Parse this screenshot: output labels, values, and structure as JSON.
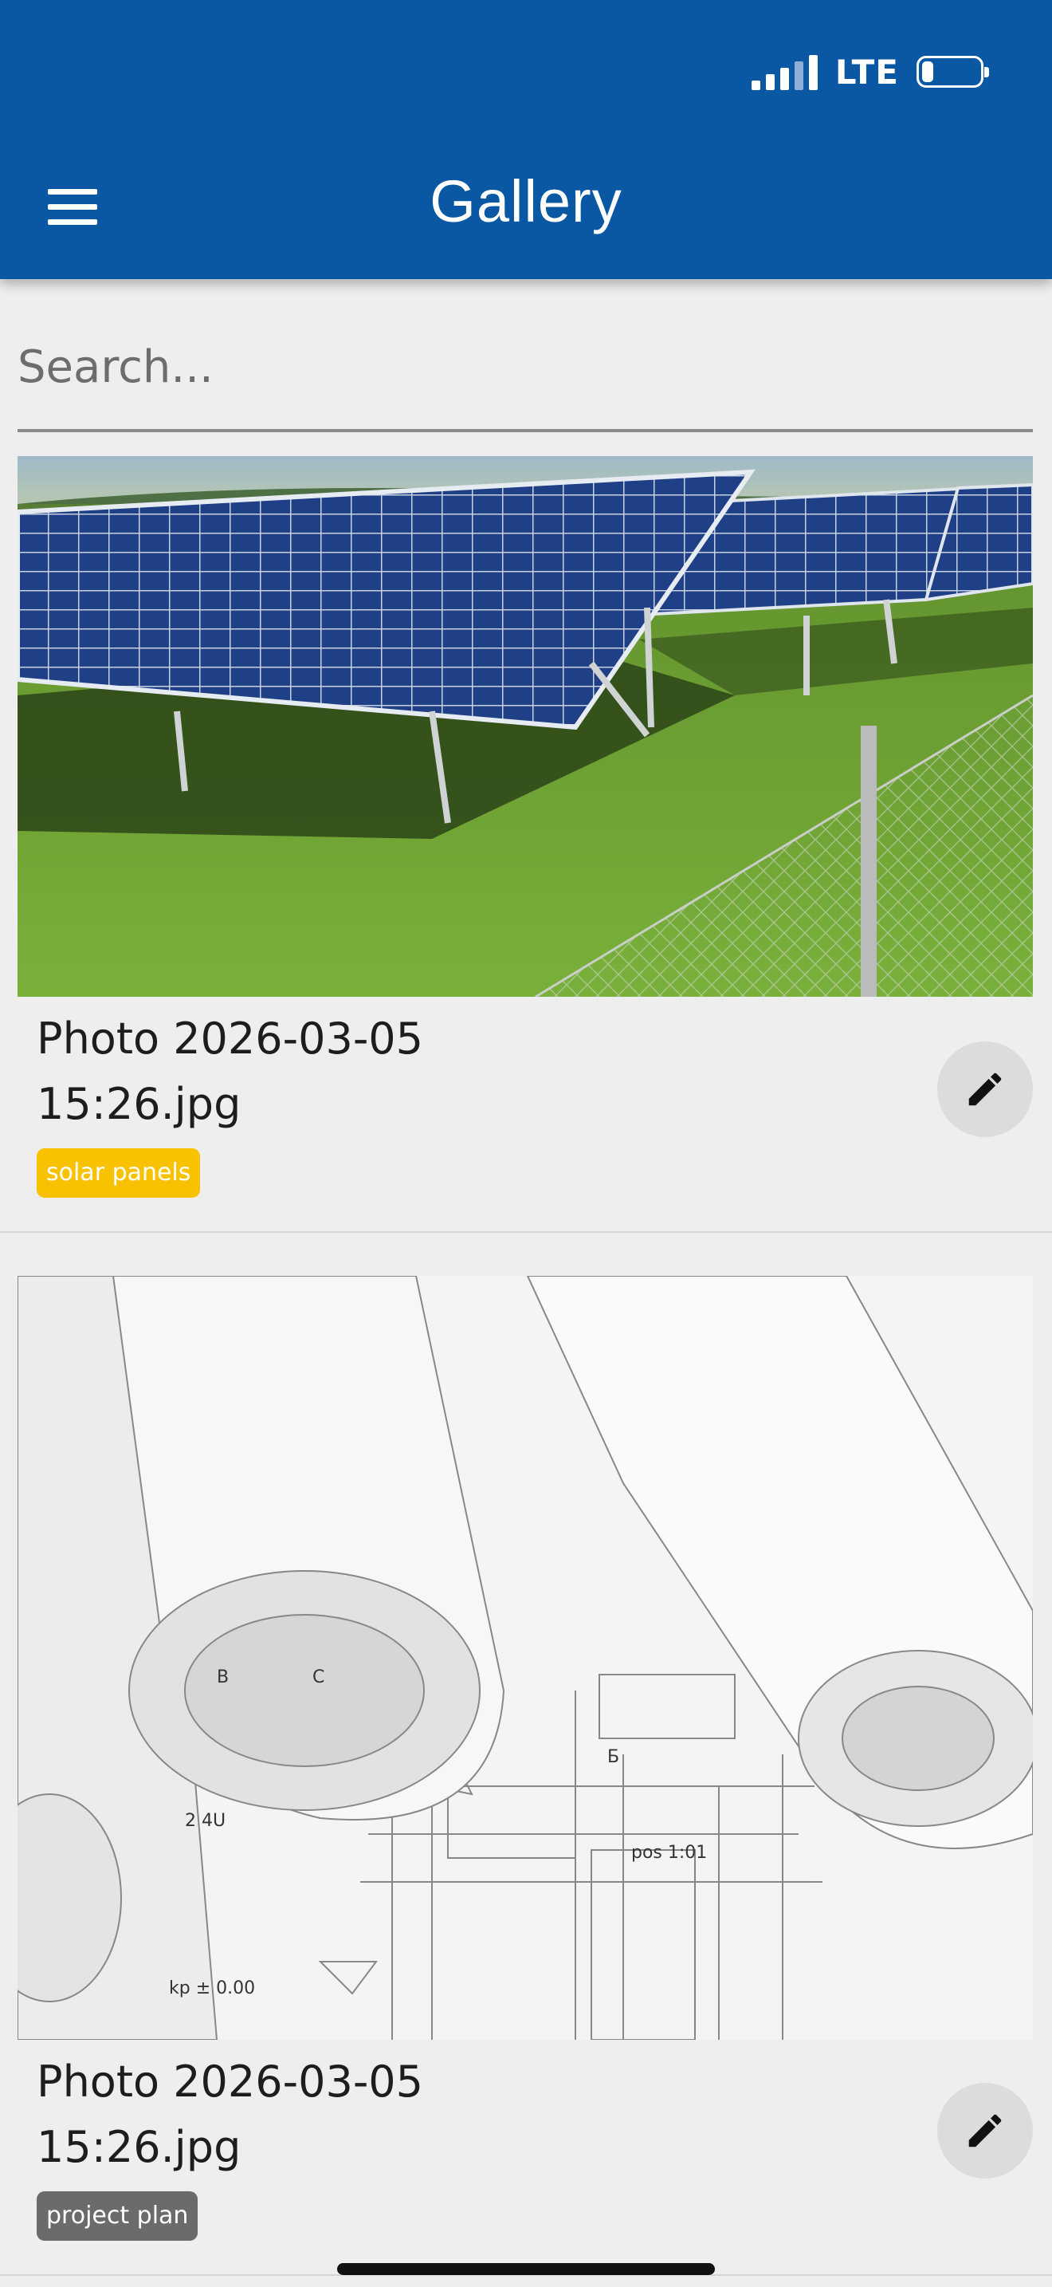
{
  "status_bar": {
    "network": "LTE"
  },
  "header": {
    "title": "Gallery"
  },
  "search": {
    "placeholder": "Search..."
  },
  "gallery": {
    "items": [
      {
        "name_line1": "Photo 2026-03-05",
        "name_line2": "15:26.jpg",
        "tag": "solar panels",
        "tag_color": "#f8c200",
        "photo_icon": "solar-panels-photo"
      },
      {
        "name_line1": "Photo 2026-03-05",
        "name_line2": "15:26.jpg",
        "tag": "project plan",
        "tag_color": "#6b6b6b",
        "photo_icon": "blueprints-photo"
      }
    ]
  },
  "colors": {
    "primary": "#0a58a4",
    "background": "#eeeeee"
  }
}
